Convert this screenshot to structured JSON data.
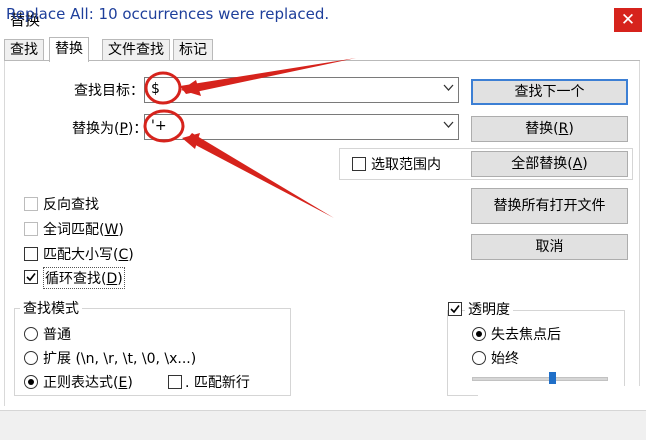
{
  "window": {
    "title": "替换",
    "close_glyph": "✕"
  },
  "tabs": [
    {
      "label": "查找"
    },
    {
      "label": "替换"
    },
    {
      "label": "文件查找"
    },
    {
      "label": "标记"
    }
  ],
  "find": {
    "label": "查找目标：",
    "value": "$"
  },
  "replace": {
    "label_prefix": "替换为(",
    "label_key": "P",
    "label_suffix": ")：",
    "value": "'+"
  },
  "selection_scope": {
    "label": "选取范围内",
    "checked": false
  },
  "buttons": {
    "find_next": "查找下一个",
    "replace_prefix": "替换(",
    "replace_key": "R",
    "replace_suffix": ")",
    "replace_all_prefix": "全部替换(",
    "replace_all_key": "A",
    "replace_all_suffix": ")",
    "replace_all_open": "替换所有打开文件",
    "cancel": "取消"
  },
  "options": {
    "reverse": {
      "label": "反向查找",
      "checked": false
    },
    "whole_word": {
      "label_prefix": "全词匹配(",
      "key": "W",
      "label_suffix": ")",
      "checked": false
    },
    "match_case": {
      "label_prefix": "匹配大小写(",
      "key": "C",
      "label_suffix": ")",
      "checked": false
    },
    "wrap": {
      "label_prefix": "循环查找(",
      "key": "D",
      "label_suffix": ")",
      "checked": true
    }
  },
  "search_mode": {
    "title": "查找模式",
    "normal": {
      "label": "普通"
    },
    "extended": {
      "label": "扩展 (\\n, \\r, \\t, \\0, \\x...)"
    },
    "regex": {
      "label_prefix": "正则表达式(",
      "key": "E",
      "label_suffix": ")"
    },
    "dot_newline": {
      "label_prefix": ". ",
      "label": "匹配新行"
    }
  },
  "transparency": {
    "title": "透明度",
    "checked": true,
    "on_lose_focus": "失去焦点后",
    "always": "始终",
    "level": 0.6
  },
  "status": {
    "text": "Replace All: 10 occurrences were replaced."
  },
  "colors": {
    "annotation": "#d6231c",
    "accent": "#3c7fd4",
    "status_text": "#1e3f9b"
  }
}
